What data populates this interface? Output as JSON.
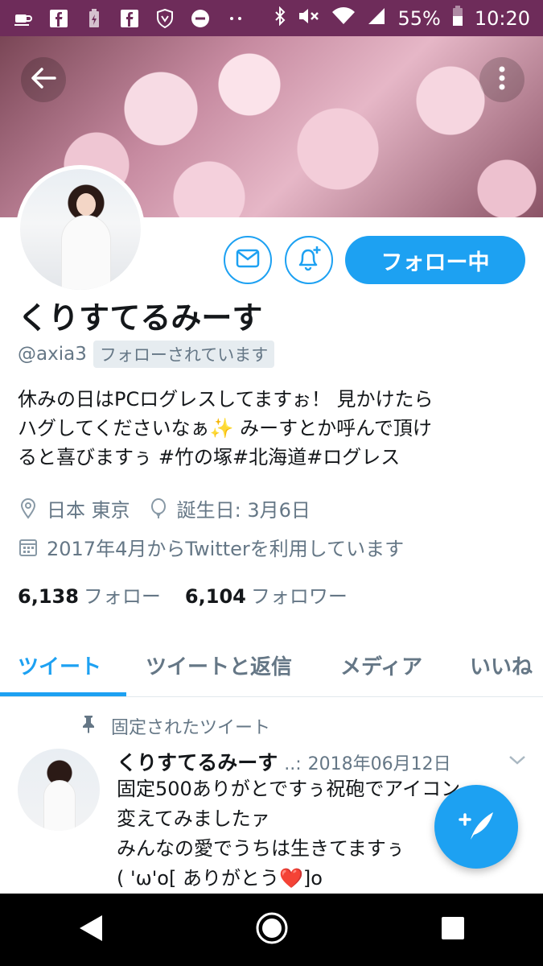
{
  "status_bar": {
    "battery": "55%",
    "time": "10:20",
    "left_icons": [
      "coffee-icon",
      "facebook-icon",
      "battery-alert-icon",
      "facebook-icon",
      "shield-icon",
      "do-not-disturb-icon",
      "more-dots-icon"
    ],
    "right_icons": [
      "bluetooth-icon",
      "mute-icon",
      "wifi-icon",
      "signal-icon",
      "battery-icon"
    ],
    "background": "#6e2c5a"
  },
  "profile": {
    "display_name": "くりすてるみーす",
    "handle": "@axia3",
    "follows_you_badge": "フォローされています",
    "bio": "休みの日はPCログレスしてますぉ！ 見かけたら\nハグしてくださいなぁ✨ みーすとか呼んで頂け\nると喜びますぅ #竹の塚#北海道#ログレス",
    "location": "日本 東京",
    "birthday": "誕生日: 3月6日",
    "joined": "2017年4月からTwitterを利用しています",
    "following_count": "6,138",
    "following_label": "フォロー",
    "followers_count": "6,104",
    "followers_label": "フォロワー"
  },
  "actions": {
    "follow_button_label": "フォロー中"
  },
  "tabs": [
    {
      "label": "ツイート",
      "active": true
    },
    {
      "label": "ツイートと返信",
      "active": false
    },
    {
      "label": "メディア",
      "active": false
    },
    {
      "label": "いいね",
      "active": false
    }
  ],
  "pinned_tweet": {
    "pinned_label": "固定されたツイート",
    "author_name": "くりすてるみーす",
    "handle_truncated": "..:",
    "date": "2018年06月12日",
    "text": "固定500ありがとですぅ祝砲でアイコン\n変えてみましたァ\nみんなの愛でうちは生きてますぅ\n( 'ω'o[  ありがとう❤️]o"
  },
  "colors": {
    "accent": "#1da1f2",
    "secondary_text": "#657786",
    "primary_text": "#14171a"
  }
}
